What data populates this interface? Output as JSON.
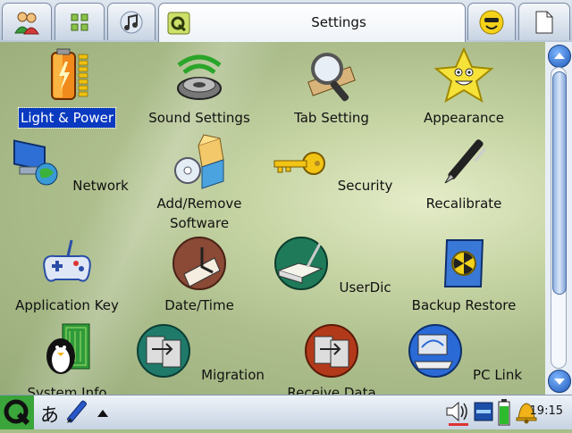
{
  "header": {
    "title": "Settings",
    "tabs": [
      {
        "name": "users-tab",
        "icon": "users-icon"
      },
      {
        "name": "applications-tab",
        "icon": "grid-icon"
      },
      {
        "name": "multimedia-tab",
        "icon": "music-note-icon"
      },
      {
        "name": "settings-tab",
        "icon": "settings-icon",
        "active": true
      },
      {
        "name": "games-tab",
        "icon": "smiley-icon"
      },
      {
        "name": "documents-tab",
        "icon": "document-icon"
      }
    ]
  },
  "apps": [
    {
      "label": "Light & Power",
      "icon": "battery-icon",
      "selected": true
    },
    {
      "label": "Sound Settings",
      "icon": "speaker-icon"
    },
    {
      "label": "Tab Setting",
      "icon": "magnifier-icon"
    },
    {
      "label": "Appearance",
      "icon": "star-icon"
    },
    {
      "label": "Network",
      "icon": "network-icon"
    },
    {
      "label": "Add/Remove\nSoftware",
      "icon": "package-icon"
    },
    {
      "label": "Security",
      "icon": "key-icon"
    },
    {
      "label": "Recalibrate",
      "icon": "pen-icon"
    },
    {
      "label": "Application Key",
      "icon": "gamepad-icon"
    },
    {
      "label": "Date/Time",
      "icon": "clock-icon"
    },
    {
      "label": "UserDic",
      "icon": "book-icon"
    },
    {
      "label": "Backup Restore",
      "icon": "backup-icon"
    },
    {
      "label": "System Info",
      "icon": "penguin-icon"
    },
    {
      "label": "Migration",
      "icon": "migration-icon"
    },
    {
      "label": "Receive Data",
      "icon": "receive-icon"
    },
    {
      "label": "PC Link",
      "icon": "pc-link-icon"
    }
  ],
  "taskbar": {
    "input_method": "あ",
    "clock": "19:15",
    "battery_color": "#2dbb2d"
  },
  "colors": {
    "selection": "#0a3ac0",
    "tab_border": "#7a8aa3",
    "background": "#b3c495"
  }
}
